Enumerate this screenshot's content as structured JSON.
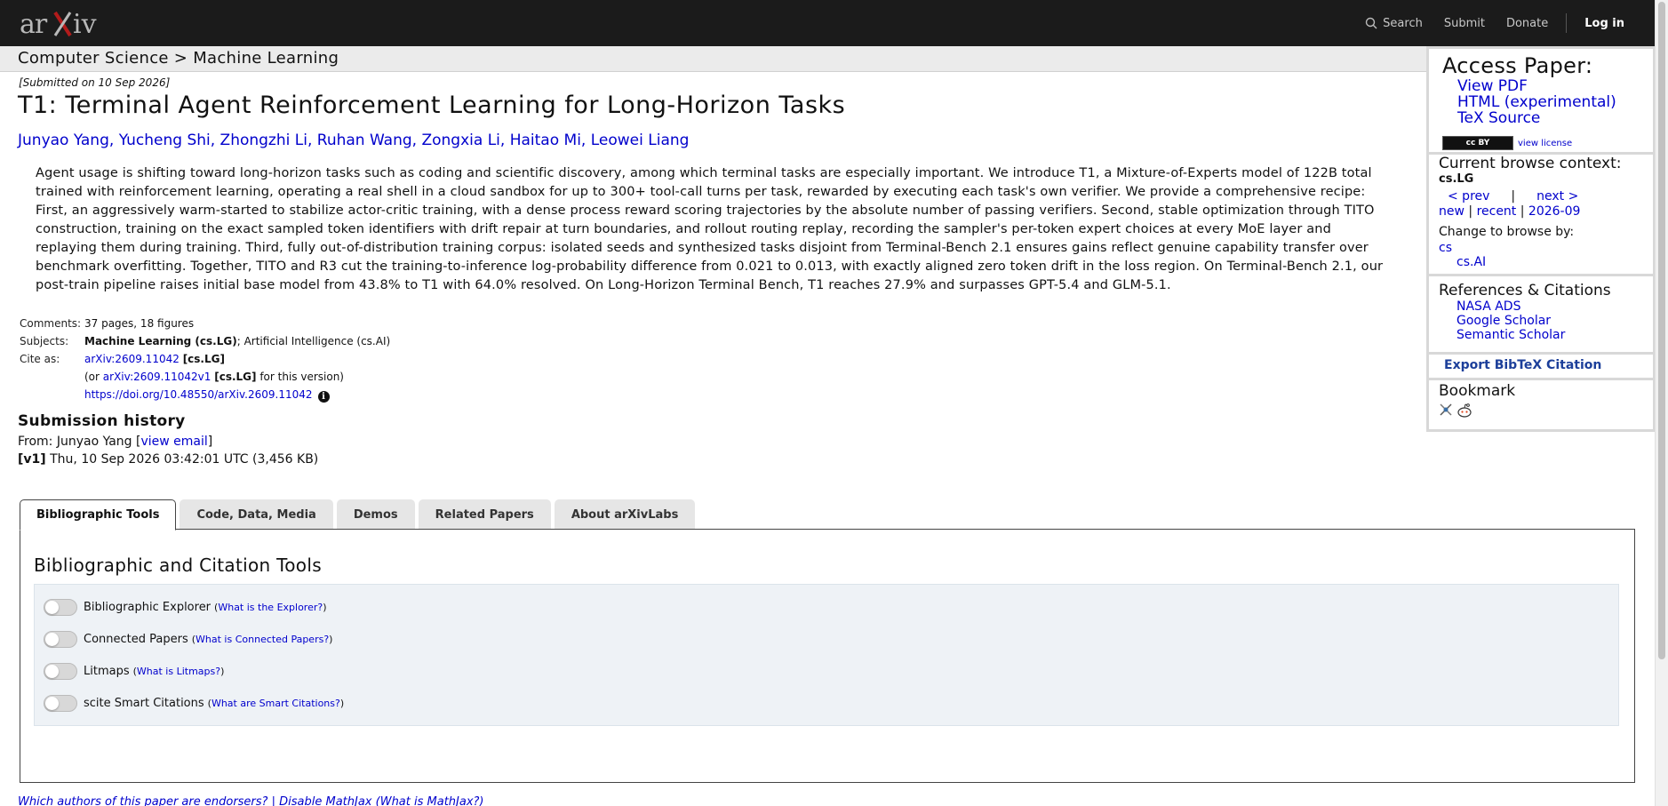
{
  "header": {
    "logo_text": "arXiv",
    "nav": {
      "search": "Search",
      "submit": "Submit",
      "donate": "Donate",
      "login": "Log in"
    }
  },
  "breadcrumb": "Computer Science > Machine Learning",
  "paper": {
    "submitted": "[Submitted on 10 Sep 2026]",
    "title": "T1: Terminal Agent Reinforcement Learning for Long-Horizon Tasks",
    "authors": [
      "Junyao Yang",
      "Yucheng Shi",
      "Zhongzhi Li",
      "Ruhan Wang",
      "Zongxia Li",
      "Haitao Mi",
      "Leowei Liang"
    ],
    "abstract": "Agent usage is shifting toward long-horizon tasks such as coding and scientific discovery, among which terminal tasks are especially important. We introduce T1, a Mixture-of-Experts model of 122B total trained with reinforcement learning, operating a real shell in a cloud sandbox for up to 300+ tool-call turns per task, rewarded by executing each task's own verifier. We provide a comprehensive recipe: First, an aggressively warm-started to stabilize actor-critic training, with a dense process reward scoring trajectories by the absolute number of passing verifiers. Second, stable optimization through TITO construction, training on the exact sampled token identifiers with drift repair at turn boundaries, and rollout routing replay, recording the sampler's per-token expert choices at every MoE layer and replaying them during training. Third, fully out-of-distribution training corpus: isolated seeds and synthesized tasks disjoint from Terminal-Bench 2.1 ensures gains reflect genuine capability transfer over benchmark overfitting. Together, TITO and R3 cut the training-to-inference log-probability difference from 0.021 to 0.013, with exactly aligned zero token drift in the loss region. On Terminal-Bench 2.1, our post-train pipeline raises initial base model from 43.8% to T1 with 64.0% resolved. On Long-Horizon Terminal Bench, T1 reaches 27.9% and surpasses GPT-5.4 and GLM-5.1.",
    "meta": {
      "comments_label": "Comments:",
      "comments": "37 pages, 18 figures",
      "subjects_label": "Subjects:",
      "subjects_primary": "Machine Learning (cs.LG)",
      "subjects_rest": "; Artificial Intelligence (cs.AI)",
      "cite_label": "Cite as:",
      "cite_id": "arXiv:2609.11042",
      "cite_cat": "[cs.LG]",
      "cite_or": "(or",
      "cite_version_id": "arXiv:2609.11042v1",
      "cite_version_cat": "[cs.LG]",
      "cite_version_suffix": "for this version)",
      "doi": "https://doi.org/10.48550/arXiv.2609.11042",
      "info_glyph": "i"
    },
    "history": {
      "title": "Submission history",
      "from_prefix": "From: Junyao Yang [",
      "view_email": "view email",
      "from_suffix": "]",
      "v1_label": "[v1]",
      "v1_detail": "Thu, 10 Sep 2026 03:42:01 UTC (3,456 KB)"
    }
  },
  "sidebar": {
    "access": {
      "title": "Access Paper:",
      "links": [
        "View PDF",
        "HTML (experimental)",
        "TeX Source"
      ],
      "license_badge": "cc BY",
      "view_license": "view license"
    },
    "context": {
      "title": "Current browse context:",
      "category": "cs.LG",
      "prev": "< prev",
      "bar": "|",
      "next": "next >",
      "new": "new",
      "recent": "recent",
      "month": "2026-09",
      "pipe": "|",
      "change_label": "Change to browse by:",
      "cs": "cs",
      "csai": "cs.AI"
    },
    "refs": {
      "title": "References & Citations",
      "links": [
        "NASA ADS",
        "Google Scholar",
        "Semantic Scholar"
      ]
    },
    "export": "Export BibTeX Citation",
    "bookmark": {
      "title": "Bookmark"
    }
  },
  "tabs": [
    "Bibliographic Tools",
    "Code, Data, Media",
    "Demos",
    "Related Papers",
    "About arXivLabs"
  ],
  "panel": {
    "title": "Bibliographic and Citation Tools",
    "tools": [
      {
        "label": "Bibliographic Explorer",
        "help": "What is the Explorer?"
      },
      {
        "label": "Connected Papers",
        "help": "What is Connected Papers?"
      },
      {
        "label": "Litmaps",
        "help": "What is Litmaps?"
      },
      {
        "label": "scite Smart Citations",
        "help": "What are Smart Citations?"
      }
    ]
  },
  "footer": {
    "endorsers": "Which authors of this paper are endorsers?",
    "sep": "|",
    "mathjax": "Disable MathJax",
    "mathjax_help": "(What is MathJax?)"
  },
  "colors": {
    "header_bg": "#1b1b1b",
    "link": "#0000cc",
    "logo_red": "#b31b1b"
  }
}
